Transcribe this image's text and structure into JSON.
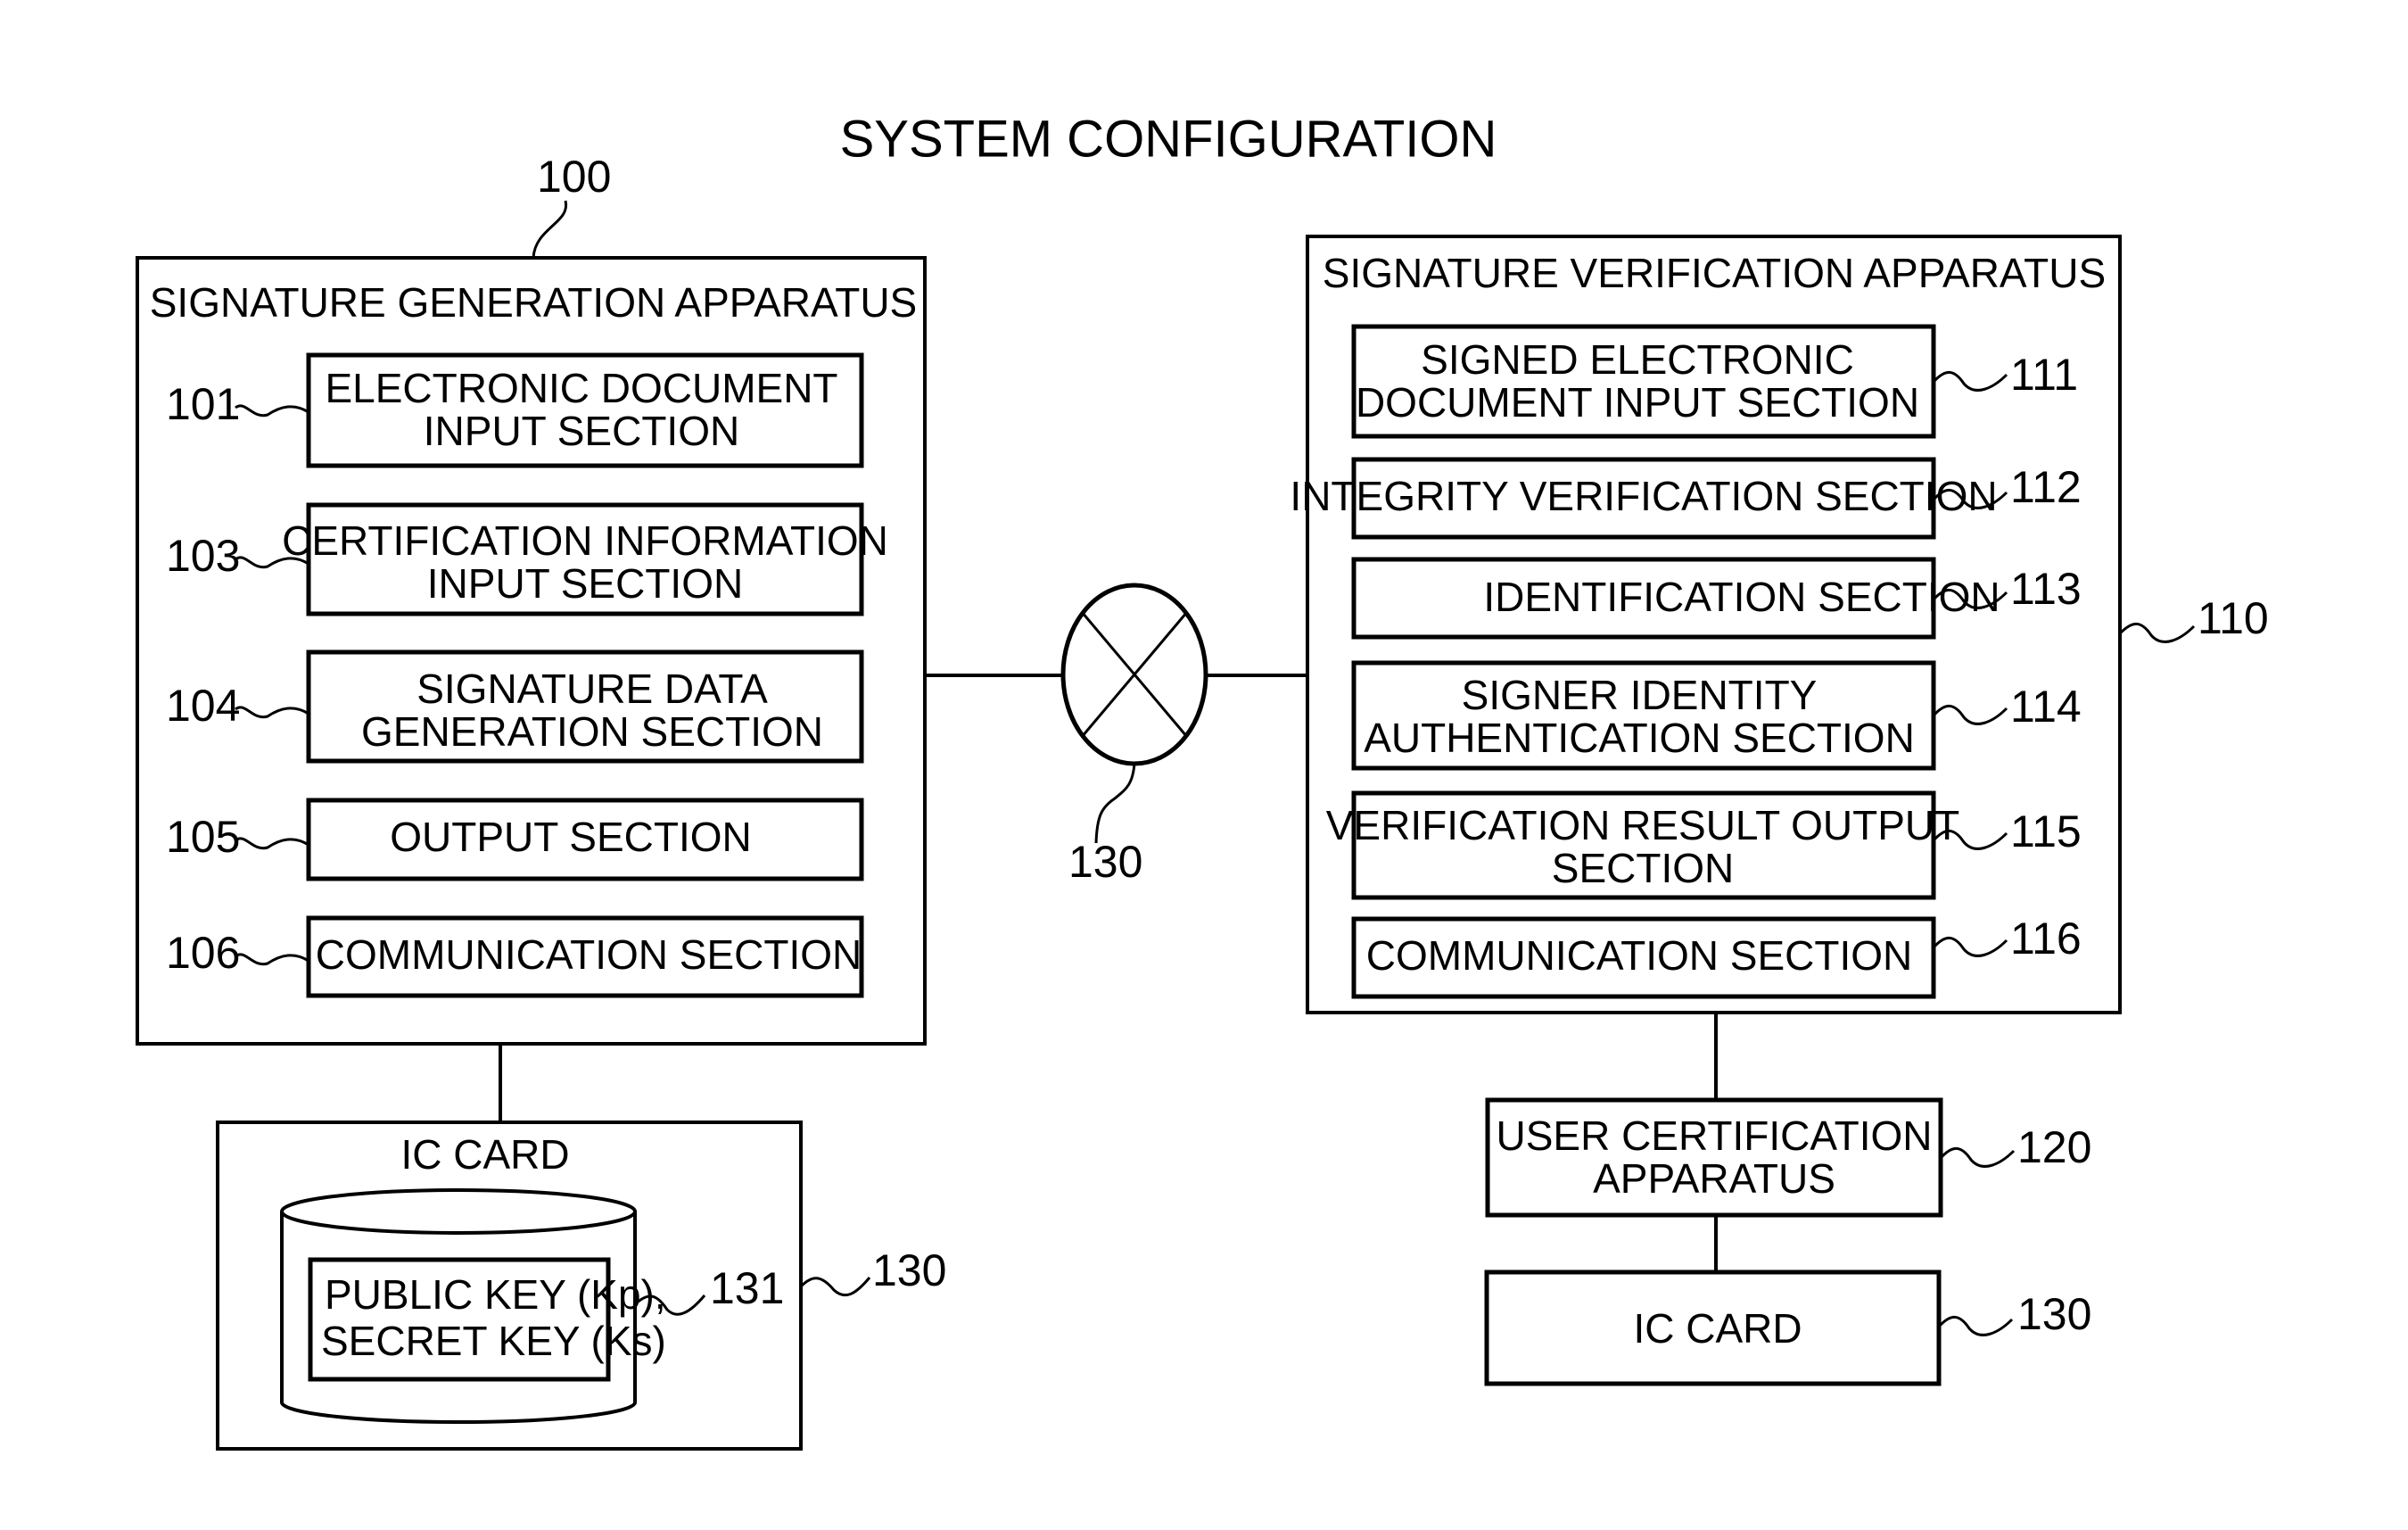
{
  "title": "SYSTEM CONFIGURATION",
  "generation_apparatus": {
    "ref": "100",
    "heading": "SIGNATURE GENERATION APPARATUS",
    "sections": [
      {
        "ref": "101",
        "lines": [
          "ELECTRONIC DOCUMENT",
          "INPUT SECTION"
        ]
      },
      {
        "ref": "103",
        "lines": [
          "CERTIFICATION INFORMATION",
          "INPUT SECTION"
        ]
      },
      {
        "ref": "104",
        "lines": [
          "SIGNATURE DATA",
          "GENERATION SECTION"
        ]
      },
      {
        "ref": "105",
        "lines": [
          "OUTPUT SECTION"
        ]
      },
      {
        "ref": "106",
        "lines": [
          "COMMUNICATION SECTION"
        ]
      }
    ],
    "ic_card": {
      "ref": "130",
      "heading": "IC CARD",
      "storage": {
        "ref": "131",
        "lines": [
          "PUBLIC KEY (Kp),",
          "SECRET KEY (Ks)"
        ]
      }
    }
  },
  "network": {
    "ref": "130"
  },
  "verification_apparatus": {
    "ref": "110",
    "heading": "SIGNATURE VERIFICATION APPARATUS",
    "sections": [
      {
        "ref": "111",
        "lines": [
          "SIGNED ELECTRONIC",
          "DOCUMENT INPUT SECTION"
        ]
      },
      {
        "ref": "112",
        "lines": [
          "INTEGRITY VERIFICATION SECTION"
        ]
      },
      {
        "ref": "113",
        "lines": [
          "IDENTIFICATION SECTION"
        ]
      },
      {
        "ref": "114",
        "lines": [
          "SIGNER IDENTITY",
          "AUTHENTICATION SECTION"
        ]
      },
      {
        "ref": "115",
        "lines": [
          "VERIFICATION RESULT OUTPUT",
          "SECTION"
        ]
      },
      {
        "ref": "116",
        "lines": [
          "COMMUNICATION SECTION"
        ]
      }
    ]
  },
  "user_certification_apparatus": {
    "ref": "120",
    "lines": [
      "USER CERTIFICATION",
      "APPARATUS"
    ]
  },
  "ic_card_right": {
    "ref": "130",
    "label": "IC CARD"
  }
}
